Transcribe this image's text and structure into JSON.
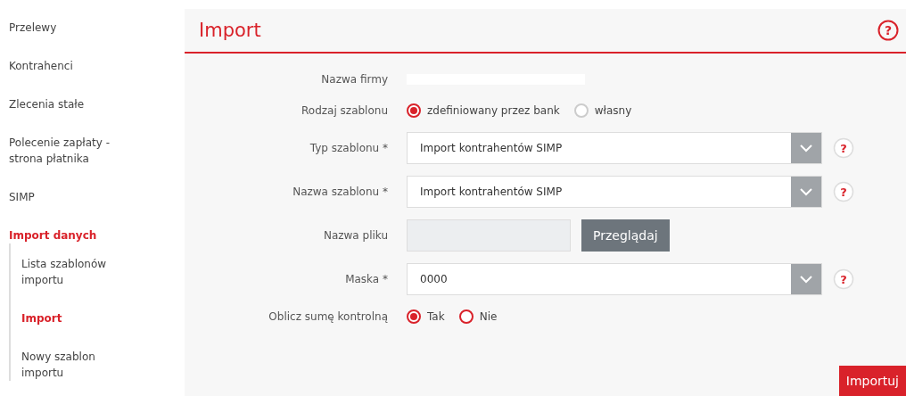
{
  "sidebar": {
    "items": [
      {
        "label": "Przelewy",
        "selected": false
      },
      {
        "label": "Kontrahenci",
        "selected": false
      },
      {
        "label": "Zlecenia stałe",
        "selected": false
      },
      {
        "label": "Polecenie zapłaty - strona płatnika",
        "selected": false
      },
      {
        "label": "SIMP",
        "selected": false
      },
      {
        "label": "Import danych",
        "selected": true,
        "children": [
          {
            "label": "Lista szablonów importu",
            "selected": false
          },
          {
            "label": "Import",
            "selected": true
          },
          {
            "label": "Nowy szablon importu",
            "selected": false
          }
        ]
      }
    ]
  },
  "page": {
    "title": "Import",
    "help": "?"
  },
  "form": {
    "fields": [
      {
        "kind": "redacted",
        "label": "Nazwa firmy"
      },
      {
        "kind": "radio",
        "label": "Rodzaj szablonu",
        "options": [
          {
            "label": "zdefiniowany przez bank",
            "selected": true
          },
          {
            "label": "własny",
            "selected": false
          }
        ]
      },
      {
        "kind": "select",
        "label": "Typ szablonu *",
        "value": "Import kontrahentów SIMP",
        "help": "?"
      },
      {
        "kind": "select",
        "label": "Nazwa szablonu *",
        "value": "Import kontrahentów SIMP",
        "help": "?"
      },
      {
        "kind": "file",
        "label": "Nazwa pliku",
        "button": "Przeglądaj"
      },
      {
        "kind": "select",
        "label": "Maska *",
        "value": "0000",
        "help": "?"
      },
      {
        "kind": "radio",
        "label": "Oblicz sumę kontrolną",
        "options": [
          {
            "label": "Tak",
            "selected": true
          },
          {
            "label": "Nie",
            "selected": false
          }
        ]
      }
    ],
    "submit": "Importuj"
  }
}
